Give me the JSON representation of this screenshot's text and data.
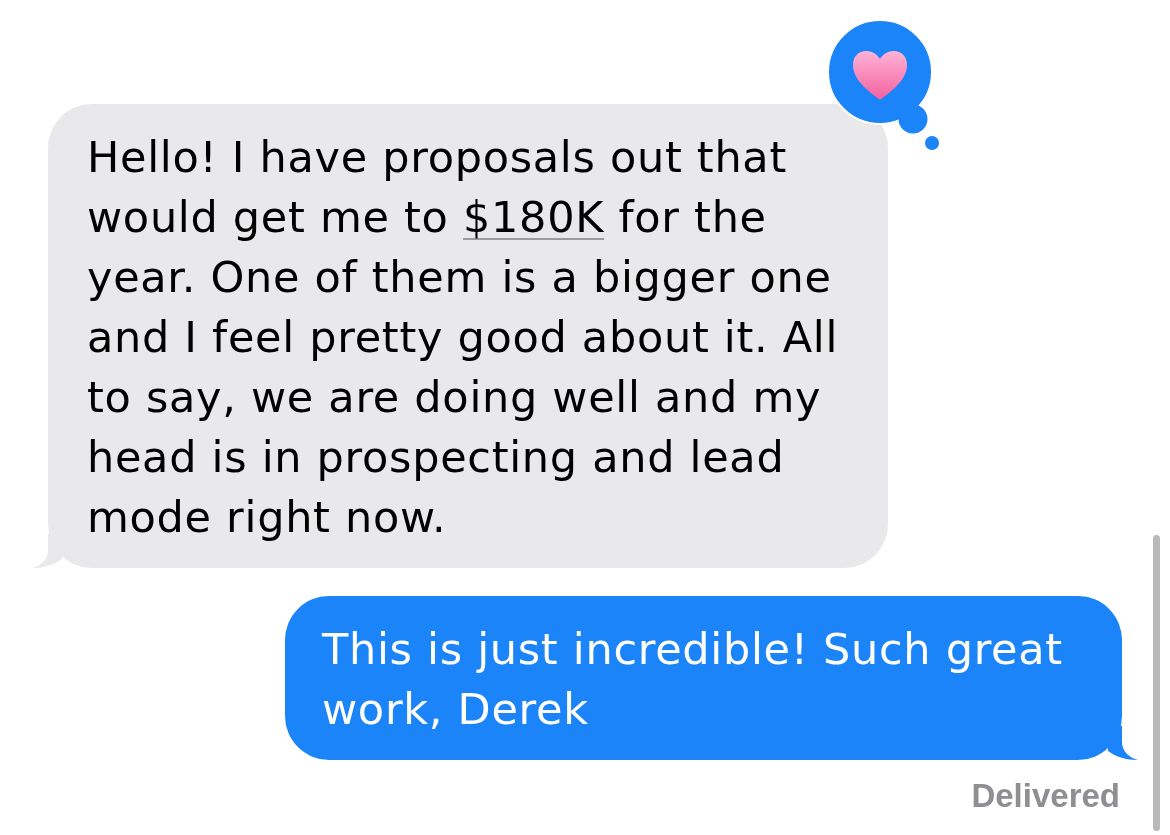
{
  "messages": [
    {
      "kind": "incoming",
      "hearted": true,
      "parts": [
        {
          "kind": "text",
          "text": "Hello! I have proposals out that would get me to "
        },
        {
          "kind": "link",
          "text": "$180K"
        },
        {
          "kind": "text",
          "text": " for the year. One of them is a bigger one and I feel pretty good about it. All to say, we are doing well and my head is in prospecting and lead mode right now."
        }
      ]
    },
    {
      "kind": "outgoing",
      "receipt": "Delivered",
      "parts": [
        {
          "kind": "text",
          "text": "This is just incredible! Such great work, Derek"
        }
      ]
    }
  ]
}
